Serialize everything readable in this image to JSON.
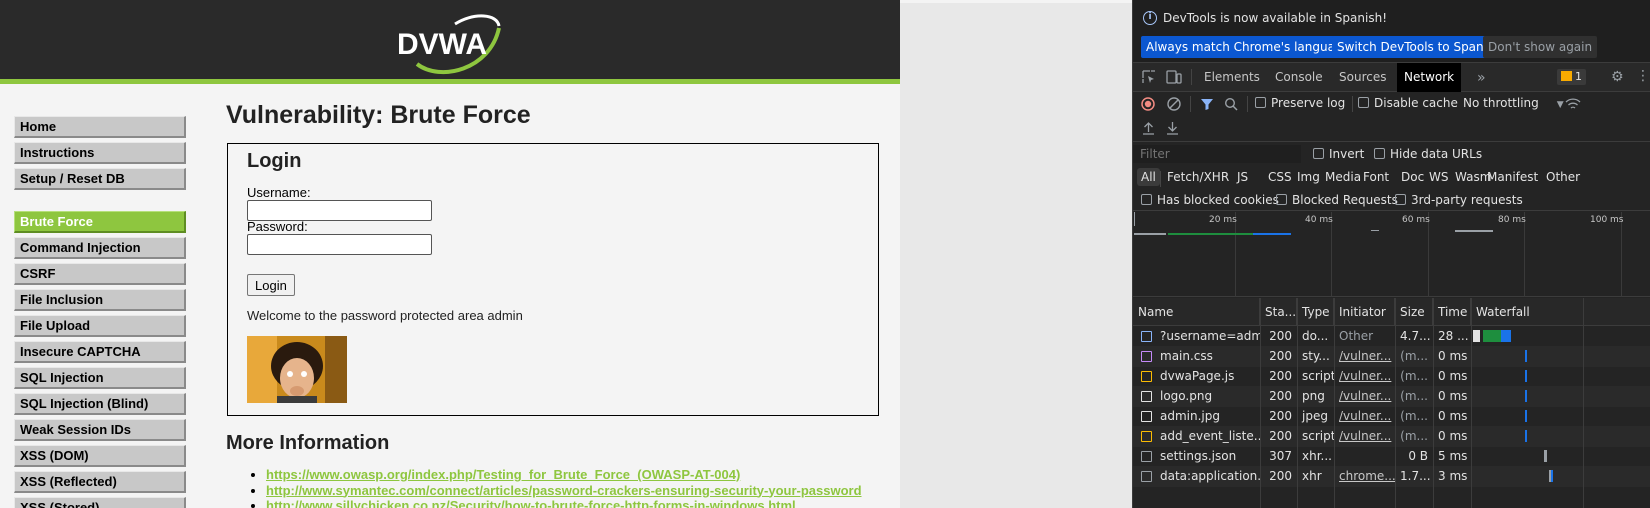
{
  "dvwa": {
    "logo_text": "DVWA",
    "menu_top": [
      "Home",
      "Instructions",
      "Setup / Reset DB"
    ],
    "menu_vulns": [
      "Brute Force",
      "Command Injection",
      "CSRF",
      "File Inclusion",
      "File Upload",
      "Insecure CAPTCHA",
      "SQL Injection",
      "SQL Injection (Blind)",
      "Weak Session IDs",
      "XSS (DOM)",
      "XSS (Reflected)",
      "XSS (Stored)"
    ],
    "selected_menu": "Brute Force",
    "page_title": "Vulnerability: Brute Force",
    "login": {
      "heading": "Login",
      "username_label": "Username:",
      "password_label": "Password:",
      "username_value": "",
      "password_value": "",
      "button": "Login",
      "welcome": "Welcome to the password protected area admin"
    },
    "more_info_heading": "More Information",
    "links": [
      "https://www.owasp.org/index.php/Testing_for_Brute_Force_(OWASP-AT-004)",
      "http://www.symantec.com/connect/articles/password-crackers-ensuring-security-your-password",
      "http://www.sillychicken.co.nz/Security/how-to-brute-force-http-forms-in-windows.html"
    ],
    "accent_color": "#8ec63f"
  },
  "devtools": {
    "info_text": "DevTools is now available in Spanish!",
    "info_buttons": [
      "Always match Chrome's language",
      "Switch DevTools to Spanish",
      "Don't show again"
    ],
    "tabs": [
      "Elements",
      "Console",
      "Sources",
      "Network"
    ],
    "active_tab": "Network",
    "issues_count": "1",
    "preserve_log": "Preserve log",
    "disable_cache": "Disable cache",
    "throttling": "No throttling",
    "filter_placeholder": "Filter",
    "invert": "Invert",
    "hide_data_urls": "Hide data URLs",
    "types": [
      "All",
      "Fetch/XHR",
      "JS",
      "CSS",
      "Img",
      "Media",
      "Font",
      "Doc",
      "WS",
      "Wasm",
      "Manifest",
      "Other"
    ],
    "blocked": [
      "Has blocked cookies",
      "Blocked Requests",
      "3rd-party requests"
    ],
    "timeline_labels": [
      "20 ms",
      "40 ms",
      "60 ms",
      "80 ms",
      "100 ms"
    ],
    "columns": [
      "Name",
      "Sta...",
      "Type",
      "Initiator",
      "Size",
      "Time",
      "Waterfall"
    ],
    "rows": [
      {
        "name": "?username=adm...",
        "status": "200",
        "type": "do...",
        "initiator": "Other",
        "size": "4.7...",
        "time": "28 ...",
        "icon": "doc-icon"
      },
      {
        "name": "main.css",
        "status": "200",
        "type": "sty...",
        "initiator": "/vulner...",
        "size": "(m...",
        "time": "0 ms",
        "icon": "css-icon"
      },
      {
        "name": "dvwaPage.js",
        "status": "200",
        "type": "script",
        "initiator": "/vulner...",
        "size": "(m...",
        "time": "0 ms",
        "icon": "js-icon"
      },
      {
        "name": "logo.png",
        "status": "200",
        "type": "png",
        "initiator": "/vulner...",
        "size": "(m...",
        "time": "0 ms",
        "icon": "image-icon"
      },
      {
        "name": "admin.jpg",
        "status": "200",
        "type": "jpeg",
        "initiator": "/vulner...",
        "size": "(m...",
        "time": "0 ms",
        "icon": "image-icon"
      },
      {
        "name": "add_event_liste...",
        "status": "200",
        "type": "script",
        "initiator": "/vulner...",
        "size": "(m...",
        "time": "0 ms",
        "icon": "js-icon"
      },
      {
        "name": "settings.json",
        "status": "307",
        "type": "xhr...",
        "initiator": "",
        "size": "0 B",
        "time": "5 ms",
        "icon": "xhr-icon"
      },
      {
        "name": "data:application...",
        "status": "200",
        "type": "xhr",
        "initiator": "chrome...",
        "size": "1.7...",
        "time": "3 ms",
        "icon": "xhr-icon"
      }
    ],
    "colors": {
      "bg": "#242424",
      "accent": "#0b57d0",
      "record": "#f28b82"
    }
  }
}
